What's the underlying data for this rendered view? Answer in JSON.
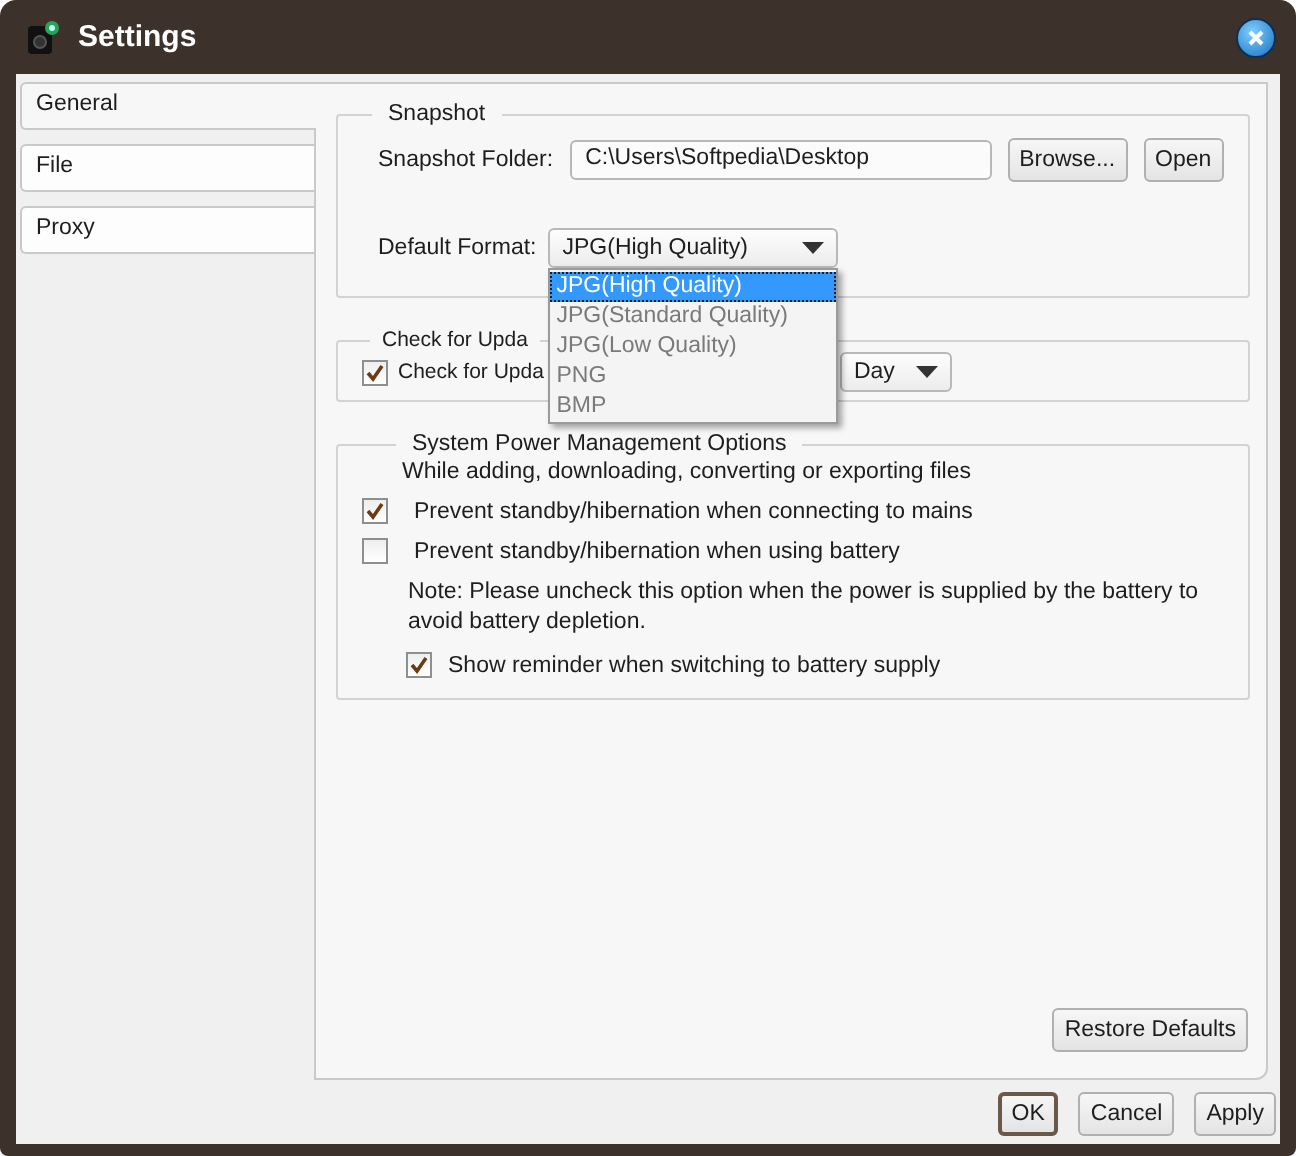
{
  "window": {
    "title": "Settings"
  },
  "tabs": [
    {
      "label": "General",
      "selected": true
    },
    {
      "label": "File",
      "selected": false
    },
    {
      "label": "Proxy",
      "selected": false
    }
  ],
  "snapshot": {
    "title": "Snapshot",
    "folder_label": "Snapshot Folder:",
    "folder": "C:\\Users\\Softpedia\\Desktop",
    "browse_button": "Browse...",
    "open_button": "Open",
    "format_label": "Default Format:",
    "format": "JPG(High Quality)",
    "format_options": [
      {
        "label": "JPG(High Quality)",
        "selected": true
      },
      {
        "label": "JPG(Standard Quality)",
        "selected": false
      },
      {
        "label": "JPG(Low Quality)",
        "selected": false
      },
      {
        "label": "PNG",
        "selected": false
      },
      {
        "label": "BMP",
        "selected": false
      }
    ]
  },
  "updates": {
    "title": "Check for Upda",
    "check": {
      "label": "Check for Upda",
      "checked": true
    },
    "frequency": "Day"
  },
  "power": {
    "title": "System Power Management Options",
    "intro": "While adding, downloading, converting or exporting files",
    "options": [
      {
        "label": "Prevent standby/hibernation when connecting to mains",
        "checked": true
      },
      {
        "label": "Prevent standby/hibernation when using battery",
        "checked": false
      }
    ],
    "note": "Note: Please uncheck this option when the power is supplied by the battery to avoid battery depletion.",
    "reminder": {
      "label": "Show reminder when switching to battery supply",
      "checked": true
    }
  },
  "restore_button": "Restore Defaults",
  "buttons": [
    {
      "label": "OK",
      "default": true
    },
    {
      "label": "Cancel",
      "default": false
    },
    {
      "label": "Apply",
      "default": false
    }
  ]
}
